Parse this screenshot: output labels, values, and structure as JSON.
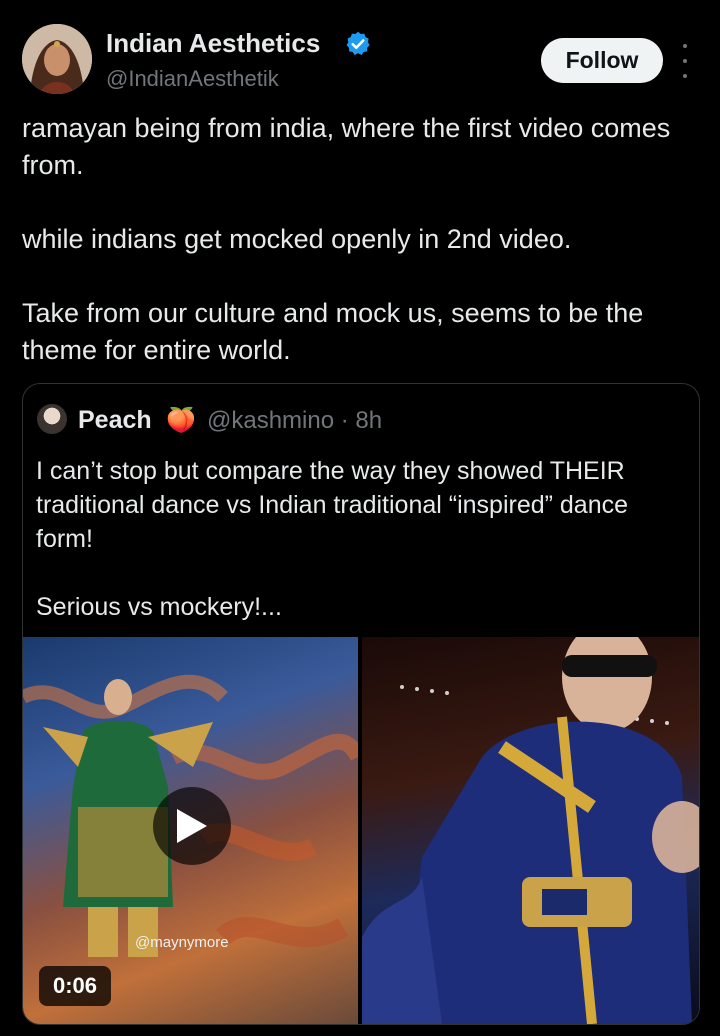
{
  "author": {
    "name": "Indian Aesthetics",
    "handle": "@IndianAesthetik",
    "verified": true,
    "verified_color": "#1d9bf0"
  },
  "follow_button": {
    "label": "Follow"
  },
  "tweet": {
    "paragraphs": [
      "ramayan being from india, where the first video comes from.",
      "while indians get mocked openly in 2nd video.",
      "Take from our culture and mock us, seems to be the theme for entire world."
    ]
  },
  "quote": {
    "name": "Peach",
    "emoji": "🍑",
    "handle": "@kashmino",
    "separator": "·",
    "time": "8h",
    "paragraphs": [
      "I can’t stop but compare the way they showed THEIR traditional dance vs Indian traditional “inspired” dance form!",
      "Serious vs mockery!..."
    ],
    "media": {
      "video_duration": "0:06",
      "watermark": "@maynymore"
    }
  },
  "colors": {
    "background": "#000000",
    "text": "#e7e9ea",
    "secondary": "#71767b",
    "border": "#2f3336"
  }
}
